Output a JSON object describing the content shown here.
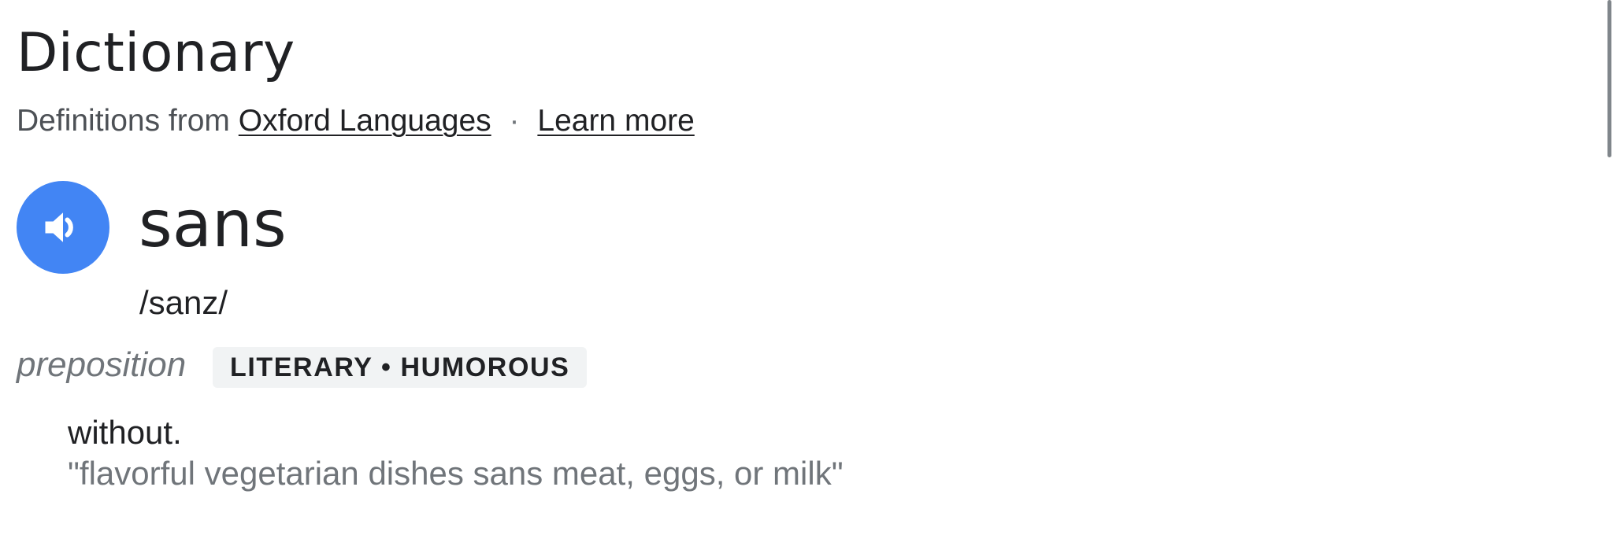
{
  "header": {
    "title": "Dictionary",
    "source_prefix": "Definitions from",
    "source_link": "Oxford Languages",
    "separator": "·",
    "learn_more": "Learn more"
  },
  "entry": {
    "audio_icon": "speaker-icon",
    "headword": "sans",
    "pronunciation": "/sanz/",
    "part_of_speech": "preposition",
    "usage_labels": "LITERARY • HUMOROUS",
    "definition": "without.",
    "example": "\"flavorful vegetarian dishes sans meat, eggs, or milk\""
  },
  "colors": {
    "accent": "#4285f4",
    "text_primary": "#202124",
    "text_secondary": "#70757a",
    "chip_background": "#f1f3f4"
  }
}
